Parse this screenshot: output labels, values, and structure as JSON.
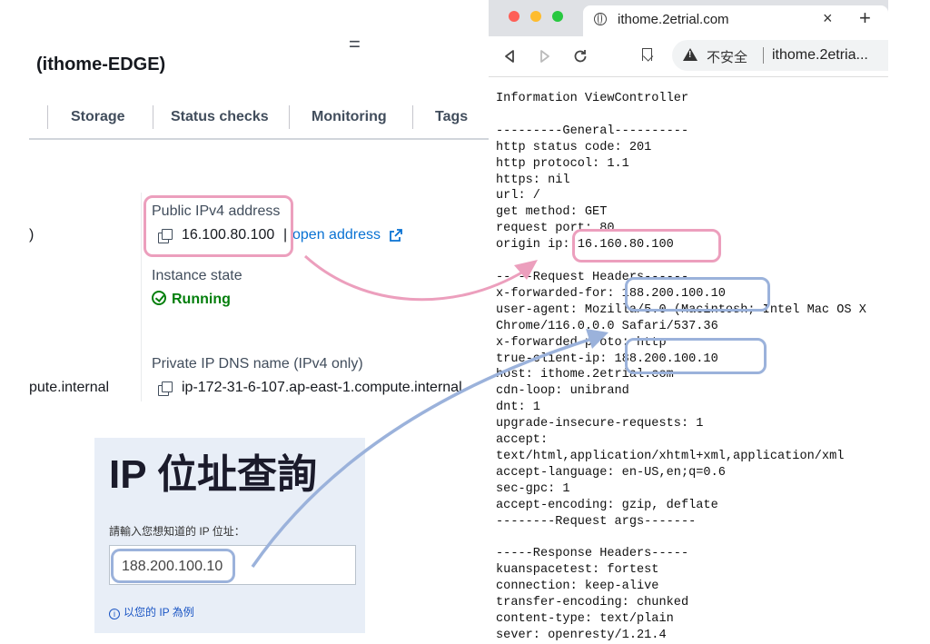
{
  "aws": {
    "title": "(ithome-EDGE)",
    "menu_icon": "hamburger-icon",
    "tabs": [
      "Storage",
      "Status checks",
      "Monitoring",
      "Tags"
    ],
    "left_fragment_1": ")",
    "left_fragment_2": "pute.internal",
    "public_ip": {
      "label": "Public IPv4 address",
      "value": "16.100.80.100",
      "separator": "|",
      "link": "open address"
    },
    "instance_state": {
      "label": "Instance state",
      "value": "Running"
    },
    "private_dns": {
      "label": "Private IP DNS name (IPv4 only)",
      "value": "ip-172-31-6-107.ap-east-1.compute.internal"
    }
  },
  "lookup": {
    "title": "IP 位址查詢",
    "label": "請輸入您想知道的 IP 位址：",
    "input_value": "188.200.100.10",
    "hint": "以您的 IP 為例"
  },
  "browser": {
    "tab_title": "ithome.2etrial.com",
    "insecure_label": "不安全",
    "url": "ithome.2etria...",
    "content_lines": [
      "Information ViewController",
      "",
      "---------General----------",
      "http status code: 201",
      "http protocol: 1.1",
      "https: nil",
      "url: /",
      "get method: GET",
      "request port: 80",
      "origin ip: 16.160.80.100",
      "",
      "-----Request Headers------",
      "x-forwarded-for: 188.200.100.10",
      "user-agent: Mozilla/5.0 (Macintosh; Intel Mac OS X",
      "Chrome/116.0.0.0 Safari/537.36",
      "x-forwarded-proto: http",
      "true-client-ip: 188.200.100.10",
      "host: ithome.2etrial.com",
      "cdn-loop: unibrand",
      "dnt: 1",
      "upgrade-insecure-requests: 1",
      "accept:",
      "text/html,application/xhtml+xml,application/xml",
      "accept-language: en-US,en;q=0.6",
      "sec-gpc: 1",
      "accept-encoding: gzip, deflate",
      "--------Request args-------",
      "",
      "-----Response Headers-----",
      "kuanspacetest: fortest",
      "connection: keep-alive",
      "transfer-encoding: chunked",
      "content-type: text/plain",
      "sever: openresty/1.21.4"
    ]
  },
  "colors": {
    "highlight_pink": "#ec9fbd",
    "highlight_blue": "#9bb2db",
    "aws_link": "#0972d3",
    "aws_running": "#037f0c"
  }
}
